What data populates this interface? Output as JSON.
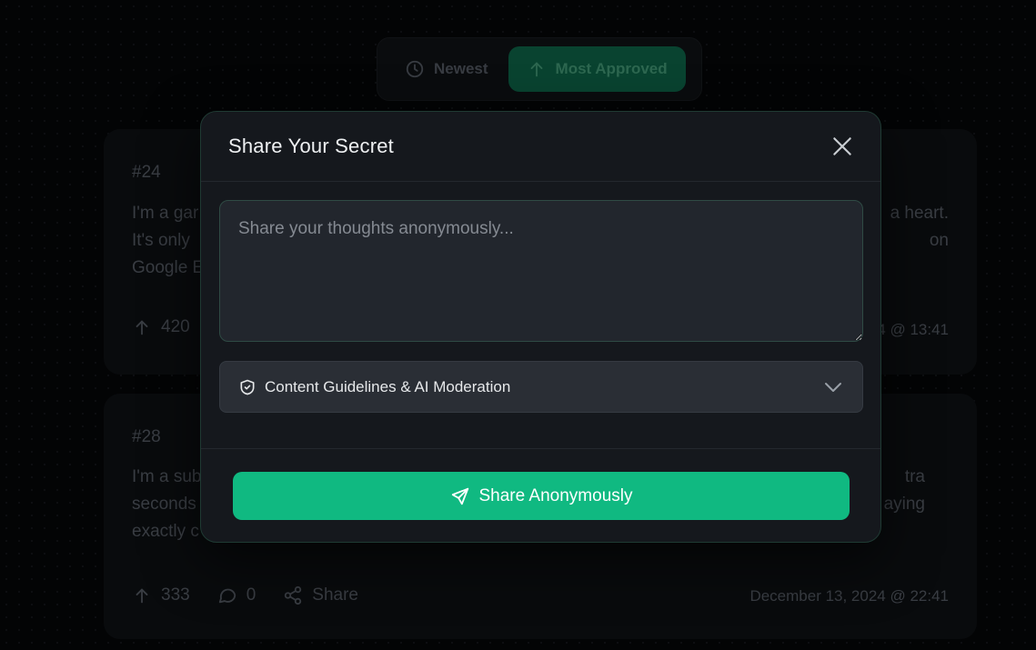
{
  "sort": {
    "newest_label": "Newest",
    "most_approved_label": "Most Approved",
    "active": "Most Approved"
  },
  "cards": [
    {
      "number": "#24",
      "text_left": "I'm a gar\nIt's only \nGoogle E",
      "text_right": "a heart.\n on",
      "votes": "420",
      "date": "4 @ 13:41"
    },
    {
      "number": "#28",
      "text_left": "I'm a sub\nseconds\nexactly c",
      "text_right": "tra\naying",
      "votes": "333",
      "comments": "0",
      "share_label": "Share",
      "date": "December 13, 2024 @ 22:41"
    }
  ],
  "modal": {
    "title": "Share Your Secret",
    "textarea_placeholder": "Share your thoughts anonymously...",
    "guidelines_label": "Content Guidelines & AI Moderation",
    "submit_label": "Share Anonymously"
  },
  "colors": {
    "accent": "#10b981",
    "modal_bg": "#15181d",
    "page_bg": "#050607"
  },
  "icons": {
    "newest": "clock-icon",
    "most_approved": "arrow-up-icon",
    "close": "close-icon",
    "guidelines": "shield-check-icon",
    "expand": "chevron-down-icon",
    "submit": "send-icon",
    "upvote": "arrow-up-icon",
    "comments": "comment-icon",
    "share": "share-icon"
  }
}
